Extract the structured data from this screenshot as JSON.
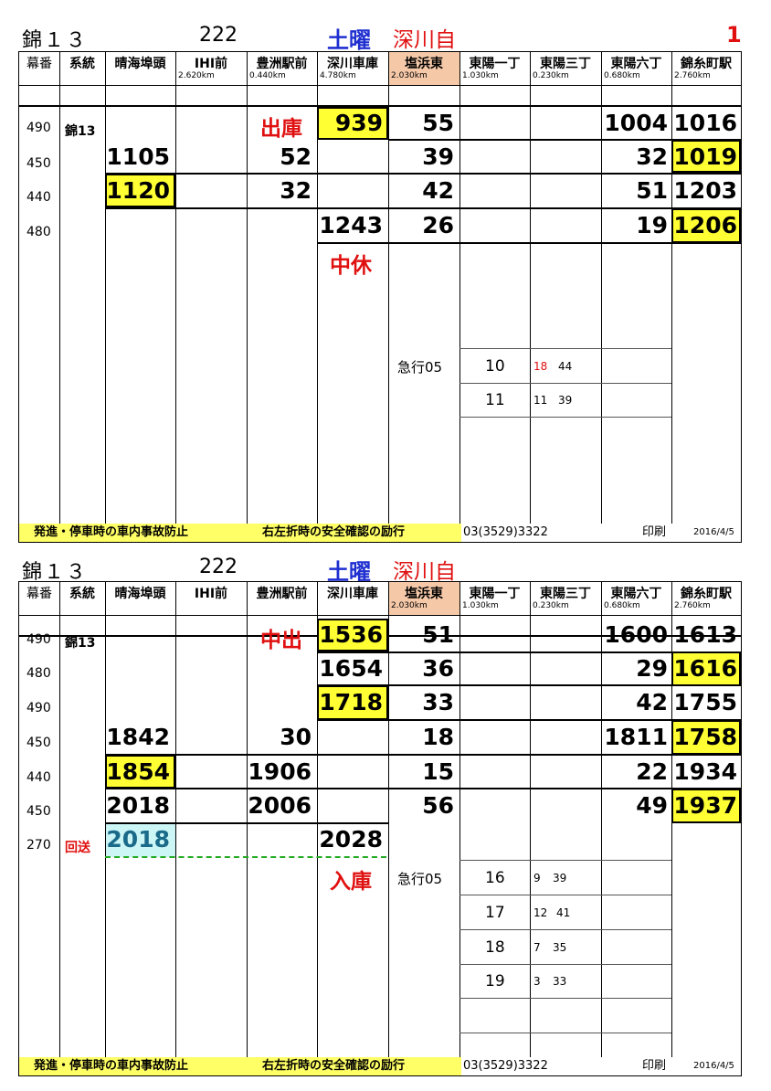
{
  "sheets": [
    {
      "route_title": "錦１３",
      "number": "222",
      "day": "土曜",
      "depot": "深川自",
      "page": "1",
      "columns": [
        "幕番",
        "系統",
        "晴海埠頭",
        "IHI前",
        "豊洲駅前",
        "深川車庫",
        "塩浜東",
        "東陽一丁",
        "東陽三丁",
        "東陽六丁",
        "錦糸町駅"
      ],
      "km": [
        "",
        "",
        "",
        "2.620km",
        "0.440km",
        "4.780km",
        "2.030km",
        "1.030km",
        "0.230km",
        "0.680km",
        "2.760km"
      ],
      "rows": [
        {
          "maku": "490",
          "keito": "錦13",
          "harumi": "",
          "ihi": "",
          "toyosu": "出庫",
          "fukagawa": "939",
          "shiohama": "55",
          "toyo1": "",
          "toyo3": "",
          "toyo6": "1004",
          "kinshi": "1016"
        },
        {
          "maku": "450",
          "keito": "",
          "harumi": "1105",
          "ihi": "",
          "toyosu": "52",
          "fukagawa": "",
          "shiohama": "39",
          "toyo1": "",
          "toyo3": "",
          "toyo6": "32",
          "kinshi": "1019"
        },
        {
          "maku": "440",
          "keito": "",
          "harumi": "1120",
          "ihi": "",
          "toyosu": "32",
          "fukagawa": "",
          "shiohama": "42",
          "toyo1": "",
          "toyo3": "",
          "toyo6": "51",
          "kinshi": "1203"
        },
        {
          "maku": "480",
          "keito": "",
          "harumi": "",
          "ihi": "",
          "toyosu": "",
          "fukagawa": "1243",
          "shiohama": "26",
          "toyo1": "",
          "toyo3": "",
          "toyo6": "19",
          "kinshi": "1206"
        }
      ],
      "note_red": "中休",
      "express_label": "急行05",
      "express": [
        {
          "hour": "10",
          "m1": "18",
          "m2": "44"
        },
        {
          "hour": "11",
          "m1": "11",
          "m2": "39"
        }
      ],
      "footer_left": "発進・停車時の車内事故防止",
      "footer_mid": "右左折時の安全確認の励行",
      "footer_phone": "03(3529)3322",
      "footer_print": "印刷",
      "footer_date": "2016/4/5"
    },
    {
      "route_title": "錦１３",
      "number": "222",
      "day": "土曜",
      "depot": "深川自",
      "columns": [
        "幕番",
        "系統",
        "晴海埠頭",
        "IHI前",
        "豊洲駅前",
        "深川車庫",
        "塩浜東",
        "東陽一丁",
        "東陽三丁",
        "東陽六丁",
        "錦糸町駅"
      ],
      "km": [
        "",
        "",
        "",
        "",
        "",
        "",
        "2.030km",
        "1.030km",
        "0.230km",
        "0.680km",
        "2.760km"
      ],
      "rows": [
        {
          "maku": "490",
          "keito": "錦13",
          "harumi": "",
          "ihi": "",
          "toyosu": "中出",
          "fukagawa": "1536",
          "shiohama": "51",
          "toyo6": "1600",
          "kinshi": "1613"
        },
        {
          "maku": "480",
          "keito": "",
          "harumi": "",
          "ihi": "",
          "toyosu": "",
          "fukagawa": "1654",
          "shiohama": "36",
          "toyo6": "29",
          "kinshi": "1616"
        },
        {
          "maku": "490",
          "keito": "",
          "harumi": "",
          "ihi": "",
          "toyosu": "",
          "fukagawa": "1718",
          "shiohama": "33",
          "toyo6": "42",
          "kinshi": "1755"
        },
        {
          "maku": "450",
          "keito": "",
          "harumi": "1842",
          "ihi": "",
          "toyosu": "30",
          "fukagawa": "",
          "shiohama": "18",
          "toyo6": "1811",
          "kinshi": "1758"
        },
        {
          "maku": "440",
          "keito": "",
          "harumi": "1854",
          "ihi": "",
          "toyosu": "1906",
          "fukagawa": "",
          "shiohama": "15",
          "toyo6": "22",
          "kinshi": "1934"
        },
        {
          "maku": "450",
          "keito": "",
          "harumi": "2018",
          "ihi": "",
          "toyosu": "2006",
          "fukagawa": "",
          "shiohama": "56",
          "toyo6": "49",
          "kinshi": "1937"
        },
        {
          "maku": "270",
          "keito": "回送",
          "harumi": "2018",
          "ihi": "",
          "toyosu": "",
          "fukagawa": "2028",
          "shiohama": "",
          "toyo6": "",
          "kinshi": ""
        }
      ],
      "note_red": "入庫",
      "express_label": "急行05",
      "express": [
        {
          "hour": "16",
          "m1": "9",
          "m2": "39"
        },
        {
          "hour": "17",
          "m1": "12",
          "m2": "41"
        },
        {
          "hour": "18",
          "m1": "7",
          "m2": "35"
        },
        {
          "hour": "19",
          "m1": "3",
          "m2": "33"
        }
      ],
      "footer_left": "発進・停車時の車内事故防止",
      "footer_mid": "右左折時の安全確認の励行",
      "footer_phone": "03(3529)3322",
      "footer_print": "印刷",
      "footer_date": "2016/4/5"
    }
  ],
  "colors": {
    "highlight": "#ffff33",
    "shiohama_header": "#f5c8a8",
    "red": "#e01010",
    "blue": "#1f2fd0",
    "cyan": "#ccf5f5",
    "dash": "#22aa22"
  }
}
